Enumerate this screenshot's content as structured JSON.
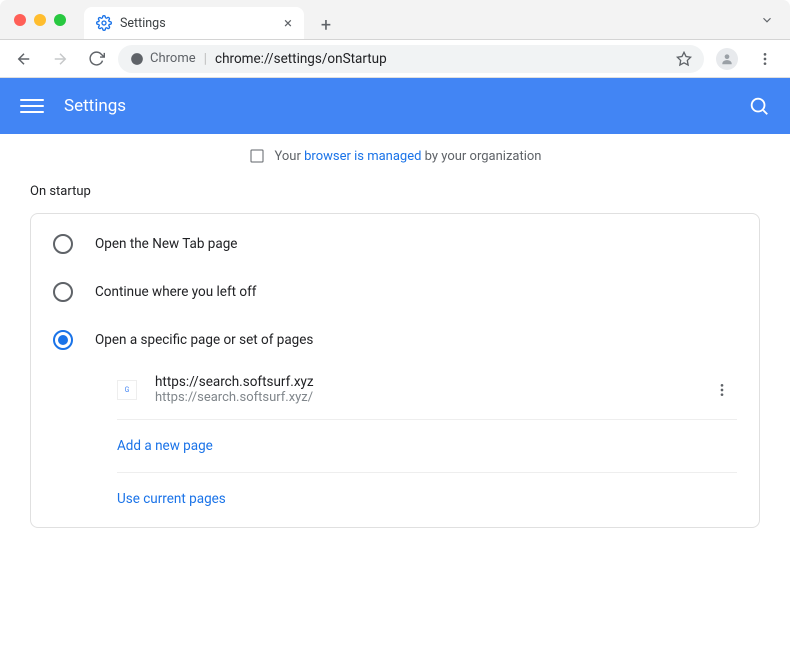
{
  "window": {
    "tab_title": "Settings"
  },
  "toolbar": {
    "site_label": "Chrome",
    "url": "chrome://settings/onStartup"
  },
  "header": {
    "title": "Settings"
  },
  "banner": {
    "prefix": "Your ",
    "link": "browser is managed",
    "suffix": " by your organization"
  },
  "section": {
    "title": "On startup"
  },
  "radios": [
    {
      "label": "Open the New Tab page",
      "selected": false
    },
    {
      "label": "Continue where you left off",
      "selected": false
    },
    {
      "label": "Open a specific page or set of pages",
      "selected": true
    }
  ],
  "startup_page": {
    "title": "https://search.softsurf.xyz",
    "url": "https://search.softsurf.xyz/"
  },
  "actions": {
    "add_page": "Add a new page",
    "use_current": "Use current pages"
  }
}
